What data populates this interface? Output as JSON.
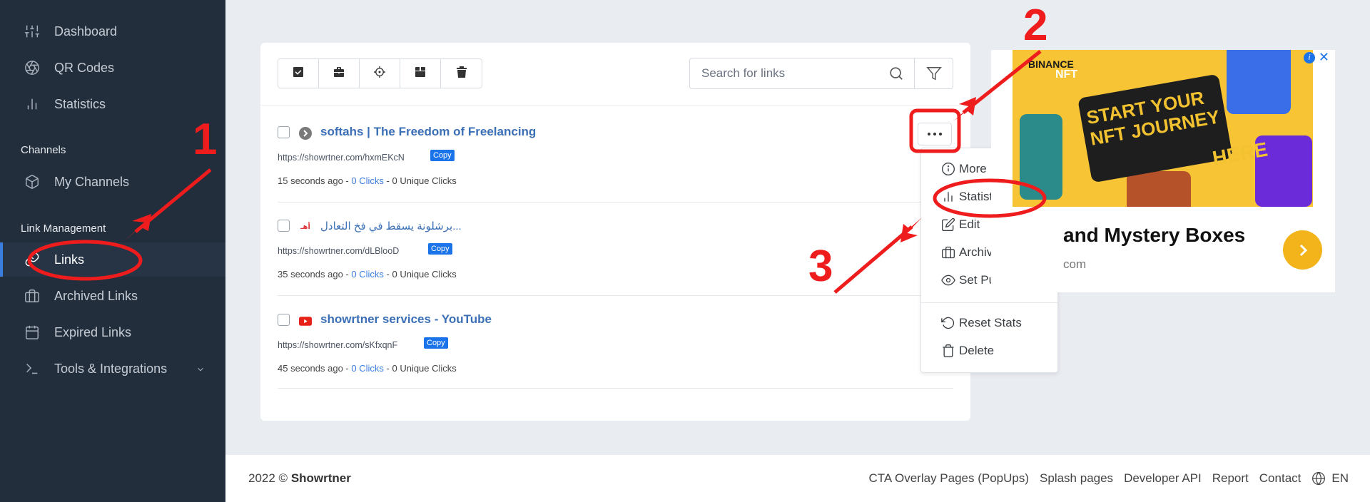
{
  "sidebar": {
    "items": [
      {
        "label": "Dashboard",
        "icon": "sliders-icon"
      },
      {
        "label": "QR Codes",
        "icon": "aperture-icon"
      },
      {
        "label": "Statistics",
        "icon": "bar-chart-icon"
      },
      {
        "label": "My Channels",
        "icon": "box-icon"
      },
      {
        "label": "Links",
        "icon": "link-icon"
      },
      {
        "label": "Archived Links",
        "icon": "archive-icon"
      },
      {
        "label": "Expired Links",
        "icon": "calendar-icon"
      },
      {
        "label": "Tools & Integrations",
        "icon": "terminal-icon"
      }
    ],
    "sections": {
      "channels": "Channels",
      "link_management": "Link Management"
    },
    "active": "Links"
  },
  "toolbar": {
    "icons": [
      "check-square-icon",
      "briefcase-icon",
      "crosshair-icon",
      "box-icon",
      "trash-icon"
    ]
  },
  "search": {
    "placeholder": "Search for links"
  },
  "links": [
    {
      "title": "softahs | The Freedom of Freelancing",
      "short_url": "https://showrtner.com/hxmEKcN",
      "copy": "Copy",
      "time": "15 seconds ago",
      "sep": "-",
      "clicks": "0 Clicks",
      "unique": "- 0 Unique Clicks",
      "favicon": "arrow-circle-icon"
    },
    {
      "title": "برشلونة يسقط في فخ التعادل...",
      "short_url": "https://showrtner.com/dLBlooD",
      "copy": "Copy",
      "time": "35 seconds ago",
      "sep": "-",
      "clicks": "0 Clicks",
      "unique": "- 0 Unique Clicks",
      "favicon": "arabic-site-icon",
      "favicon_text": "أهـ"
    },
    {
      "title": "showrtner services - YouTube",
      "short_url": "https://showrtner.com/sKfxqnF",
      "copy": "Copy",
      "time": "45 seconds ago",
      "sep": "-",
      "clicks": "0 Clicks",
      "unique": "- 0 Unique Clicks",
      "favicon": "youtube-icon"
    }
  ],
  "dropdown": {
    "items": [
      {
        "label": "More Info",
        "icon": "info-icon"
      },
      {
        "label": "Statistics",
        "icon": "bar-chart-icon"
      },
      {
        "label": "Edit",
        "icon": "edit-icon"
      },
      {
        "label": "Archive",
        "icon": "archive-icon"
      },
      {
        "label": "Set Public",
        "icon": "eye-icon"
      },
      {
        "label": "Reset Stats",
        "icon": "reset-icon"
      },
      {
        "label": "Delete",
        "icon": "trash-icon"
      }
    ]
  },
  "ad": {
    "brand": "BINANCE",
    "brand2": "NFT",
    "banner": "START YOUR NFT JOURNEY",
    "here": "HERE",
    "title": "and Mystery Boxes",
    "subtitle": "com",
    "info": "i",
    "close": "✕"
  },
  "footer": {
    "year": "2022 ©",
    "brand": "Showrtner",
    "links": [
      "CTA Overlay Pages (PopUps)",
      "Splash pages",
      "Developer API",
      "Report",
      "Contact"
    ],
    "language": "EN"
  },
  "annotations": {
    "step1": "1",
    "step2": "2",
    "step3": "3",
    "color": "#ee1c1c"
  }
}
